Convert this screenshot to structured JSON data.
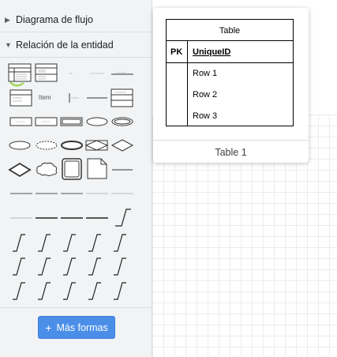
{
  "sidebar": {
    "sections": [
      {
        "label": "Diagrama de flujo",
        "expanded": false
      },
      {
        "label": "Relación de la entidad",
        "expanded": true
      }
    ],
    "item_label": "Item",
    "more_shapes_button": "Más formas",
    "more_shapes_icon": "+"
  },
  "preview": {
    "table_header": "Table",
    "pk_label": "PK",
    "pk_field": "UniqueID",
    "rows": [
      "Row 1",
      "Row 2",
      "Row 3"
    ],
    "caption": "Table 1"
  },
  "colors": {
    "accent": "#4a8ee8",
    "highlight": "#a4d65e",
    "sidebar_bg": "#f1f3f4"
  }
}
